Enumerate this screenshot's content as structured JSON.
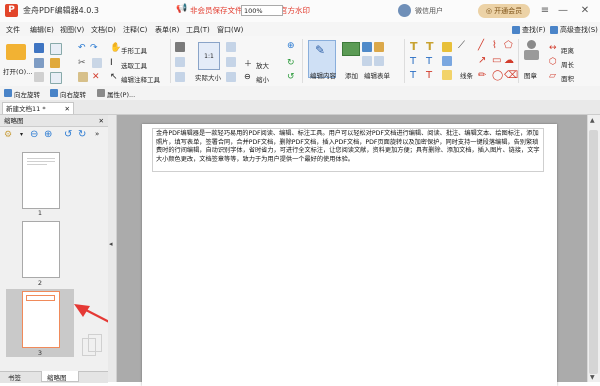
{
  "window": {
    "title": "金舟PDF编辑器4.0.3",
    "notice": "非会员保存文件会带有软件官方水印",
    "user_label": "微信用户",
    "vip_label": "开通会员",
    "colors": {
      "accent": "#e33b2e",
      "vip_bg": "#ecd2a6"
    }
  },
  "menu": {
    "items": [
      "文件",
      "编辑(E)",
      "视图(V)",
      "文档(D)",
      "注释(C)",
      "表单(R)",
      "工具(T)",
      "窗口(W)"
    ],
    "search_label": "查找(F)",
    "adv_search_label": "高级查找(S)"
  },
  "toolbar": {
    "open_label": "打开(O)...",
    "hand_tool": "手形工具",
    "select_text": "选取工具",
    "edit_annot": "编辑注释工具",
    "actual_size": "实际大小",
    "zoom_value": "100%",
    "zoom_in": "放大",
    "zoom_out": "缩小",
    "edit_content": "编辑内容",
    "add": "添加",
    "edit_form": "编辑表单",
    "line": "线条",
    "stamp": "图章",
    "distance": "距离",
    "perimeter": "周长",
    "area": "面积"
  },
  "groupbar": {
    "rotate_left": "向左旋转",
    "rotate_right": "向右旋转",
    "properties": "属性(P)..."
  },
  "tabs": {
    "doc_tab": "新建文档11 *"
  },
  "thumbnails": {
    "header": "缩略图",
    "pages": [
      "1",
      "2",
      "3"
    ]
  },
  "bottom_tabs": [
    "书签",
    "缩略图"
  ],
  "document": {
    "paragraph": "金舟PDF编辑器是一款轻巧易用的PDF阅读、编辑、标注工具。用户可以轻松对PDF文档进行编辑、阅读、批注、编辑文本、绘图标注，添加照片，填写表单，签署合同，合并PDF文档，删除PDF文档，插入PDF文档，PDF页面旋转以及加密保护，同时支持一键段落编辑，告别繁琐费时的行间编辑，自动识别字体，省时省力，可进行全文标注，让您阅读文献，资料更加方便；具有删除、添加文档，插入图片、链接，文字大小颜色更改，文档签章等等，致力于为用户提供一个最好的使用体验。"
  }
}
